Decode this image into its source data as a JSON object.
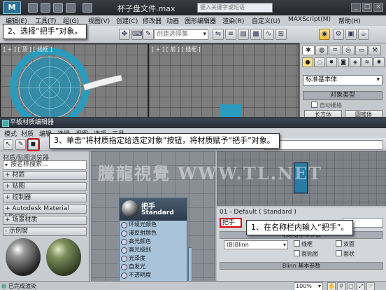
{
  "app": {
    "window_title": "杯子盘文件.max",
    "search_placeholder": "键入关键字或短语"
  },
  "main_menu": [
    "编辑(E)",
    "工具(T)",
    "组(G)",
    "视图(V)",
    "创建(C)",
    "修改器",
    "动画",
    "图形编辑器",
    "渲染(R)",
    "自定义(U)",
    "MAXScript(M)",
    "帮助(H)"
  ],
  "toolbar": {
    "selection_set_placeholder": "创建选择集"
  },
  "viewports": {
    "top_label": "[ + ] [ 顶 ] [ 线框 ]",
    "front_label": "[ + ] [ 前 ] [ 线框 ]"
  },
  "command_panel": {
    "category_dropdown": "标准基本体",
    "rollout_object_type": "对象类型",
    "autogrid_label": "自动栅格",
    "button_box": "长方体",
    "button_cylinder": "圆锥体"
  },
  "slate_editor": {
    "title": "平板材质编辑器",
    "menu": [
      "模式",
      "材质",
      "编辑",
      "选择",
      "视图",
      "选项",
      "工具"
    ],
    "browser_header": "材质/贴图浏览器",
    "browser_search": "按名称搜索...",
    "categories": [
      "+ 材质",
      "+ 贴图",
      "+ 控制器",
      "+ Autodesk Material Library",
      "+ 场景材质",
      "- 示例窗"
    ],
    "node": {
      "name": "把手",
      "type": "Standard",
      "slots": [
        "环境光颜色",
        "漫反射颜色",
        "高光颜色",
        "高光级别",
        "光泽度",
        "自发光",
        "不透明度"
      ]
    },
    "watermark": "騰龍視覺 WWW.TL.NET",
    "material_label": "01 - Default  ( Standard )",
    "name_field_value": "把手",
    "rollout_shader": "明暗器基本参数",
    "shader_value": "(B)Blinn",
    "checkboxes": [
      "线框",
      "双面",
      "面贴图",
      "面状"
    ],
    "rollout_blinn": "Blinn 基本参数",
    "status_text": "已完成渲染",
    "zoom": "100%"
  },
  "callouts": {
    "step1": "1、在名称栏内输入“把手”。",
    "step2": "2、选择“把手”对象。",
    "step3": "3、单击“将材质指定给选定对象”按钮，将材质赋予“把手”对象。"
  },
  "colors": {
    "highlight_red": "#e00000",
    "teal_object": "#2a9bbd",
    "node_header": "#2b3a4b"
  }
}
